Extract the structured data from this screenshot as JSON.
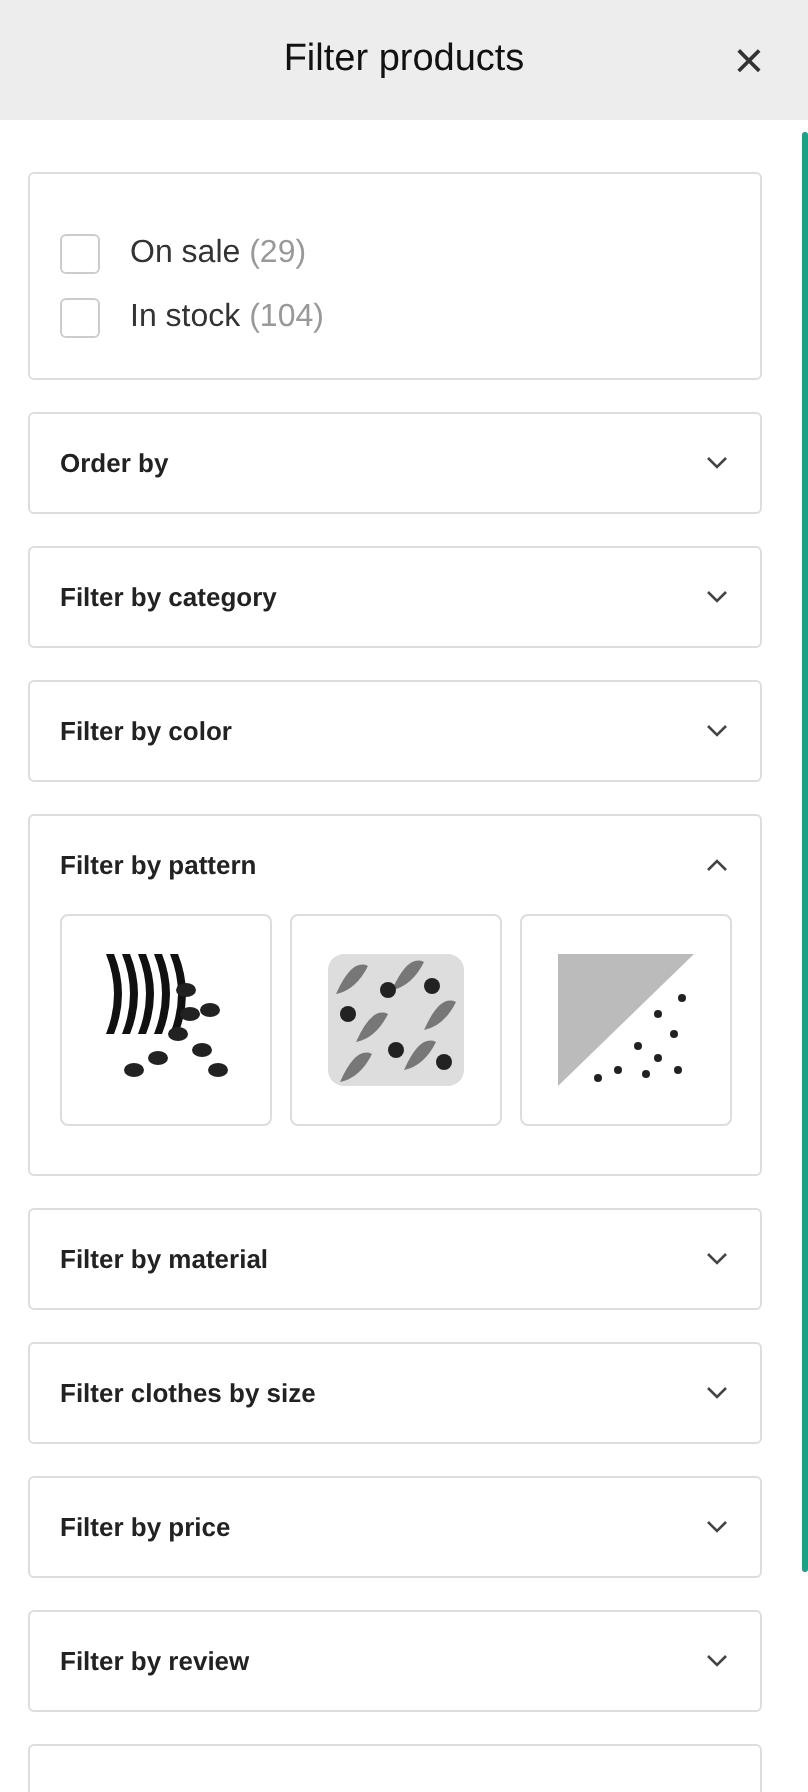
{
  "header": {
    "title": "Filter products",
    "close": "×"
  },
  "checkboxes": [
    {
      "label": "On sale",
      "count": "(29)",
      "checked": false
    },
    {
      "label": "In stock",
      "count": "(104)",
      "checked": false
    }
  ],
  "sections": [
    {
      "title": "Order by",
      "expanded": false
    },
    {
      "title": "Filter by category",
      "expanded": false
    },
    {
      "title": "Filter by color",
      "expanded": false
    },
    {
      "title": "Filter by pattern",
      "expanded": true
    },
    {
      "title": "Filter by material",
      "expanded": false
    },
    {
      "title": "Filter clothes by size",
      "expanded": false
    },
    {
      "title": "Filter by price",
      "expanded": false
    },
    {
      "title": "Filter by review",
      "expanded": false
    }
  ]
}
